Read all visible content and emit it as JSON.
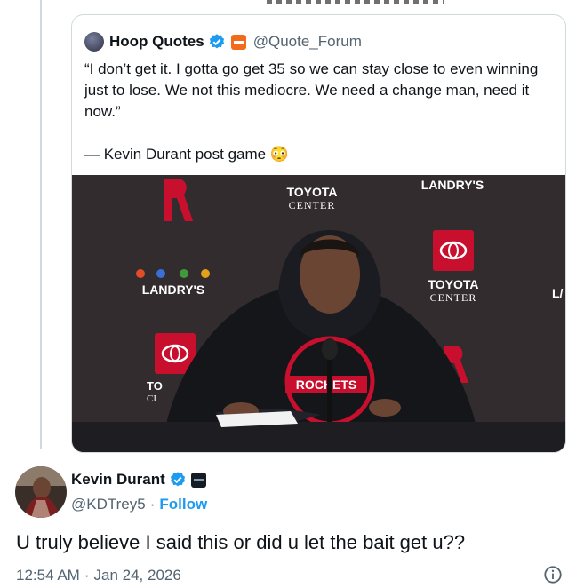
{
  "quoted_tweet": {
    "author_name": "Hoop Quotes",
    "author_handle": "@Quote_Forum",
    "text": "“I don’t get it. I gotta go get 35 so we can stay close to even winning just to lose. We not this mediocre. We need a change man, need it now.”\n\n— Kevin Durant post game 😳",
    "image": {
      "backdrop_text": {
        "toyota_word": "TOYOTA",
        "center_word": "CENTER",
        "landrys": "LANDRY'S",
        "jersey": "ROCKETS",
        "partial_left": "TO",
        "partial_left2": "CI",
        "partial_right": "L/"
      }
    },
    "colors": {
      "verified": "#1d9bf0",
      "affiliate_badge": "#f26b1d"
    }
  },
  "tweet": {
    "author_name": "Kevin Durant",
    "author_handle": "@KDTrey5",
    "separator": "·",
    "follow_label": "Follow",
    "text": "U truly believe I said this or did u let the bait get u??",
    "time": "12:54 AM",
    "date": "Jan 24, 2026",
    "colors": {
      "follow": "#1d9bf0",
      "verified": "#1d9bf0"
    }
  },
  "icons": [
    "verified-badge-icon",
    "affiliate-badge-icon",
    "info-icon"
  ]
}
